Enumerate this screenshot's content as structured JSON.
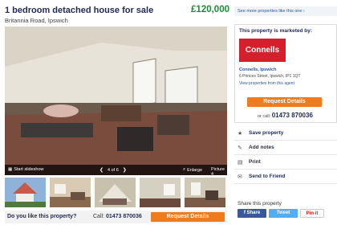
{
  "listing": {
    "title": "1 bedroom detached house for sale",
    "address": "Britannia Road, Ipswich",
    "price": "£120,000"
  },
  "gallery": {
    "slideshow_label": "Start slideshow",
    "counter": "4 of 6",
    "enlarge_label": "Enlarge",
    "picture_label": "Picture 4"
  },
  "cta": {
    "question": "Do you like this property?",
    "call_label": "Call:",
    "phone": "01473 870036",
    "request_label": "Request Details"
  },
  "sidebar": {
    "see_more": "See more properties like this one ›",
    "marketed_by": "This property is marketed by:",
    "agent_logo_text": "Connells",
    "agent_name": "Connells, Ipswich",
    "agent_address": "6 Princes Street, Ipswich, IP1 1QT",
    "agent_link": "View properties from this agent",
    "request_label": "Request Details",
    "or_call": "or call:",
    "phone": "01473 870036",
    "actions": [
      {
        "icon": "star-icon",
        "glyph": "★",
        "label": "Save property"
      },
      {
        "icon": "pencil-icon",
        "glyph": "✎",
        "label": "Add notes"
      },
      {
        "icon": "print-icon",
        "glyph": "▤",
        "label": "Print"
      },
      {
        "icon": "mail-icon",
        "glyph": "✉",
        "label": "Send to Friend"
      }
    ],
    "share_title": "Share this property",
    "share": {
      "facebook": "f  Share",
      "twitter": "Tweet",
      "pinterest": "Pin it"
    }
  },
  "colors": {
    "price": "#1c8a3a",
    "accent": "#f07b1c",
    "brand": "#d61f2c",
    "link": "#2a55a6"
  }
}
